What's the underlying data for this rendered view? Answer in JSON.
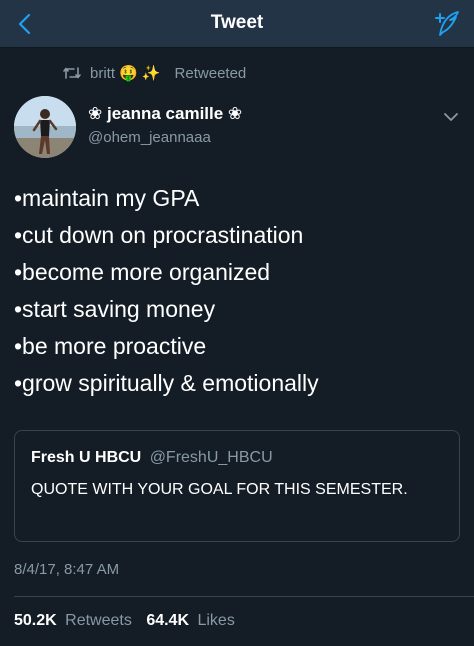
{
  "navbar": {
    "title": "Tweet",
    "back_icon": "chevron-left-icon",
    "compose_icon": "compose-quill-icon",
    "accent": "#1da1f2"
  },
  "retweet": {
    "icon": "retweet-icon",
    "name": "britt",
    "emojis": "🤑 ✨",
    "label": "Retweeted"
  },
  "tweet": {
    "author": {
      "name": "❀ jeanna camille ❀",
      "handle": "@ohem_jeannaaa"
    },
    "lines": [
      "•maintain my GPA",
      "•cut down on procrastination",
      "•become more organized",
      "•start saving money",
      "•be more proactive",
      "•grow spiritually & emotionally"
    ],
    "timestamp": "8/4/17, 8:47 AM"
  },
  "quote": {
    "name": "Fresh U HBCU",
    "handle": "@FreshU_HBCU",
    "text": "QUOTE WITH YOUR GOAL FOR THIS SEMESTER."
  },
  "stats": {
    "retweets_count": "50.2K",
    "retweets_label": "Retweets",
    "likes_count": "64.4K",
    "likes_label": "Likes"
  },
  "colors": {
    "background": "#141d26",
    "navbar": "#243447",
    "secondary_text": "#8899a6",
    "border": "#38444d"
  }
}
